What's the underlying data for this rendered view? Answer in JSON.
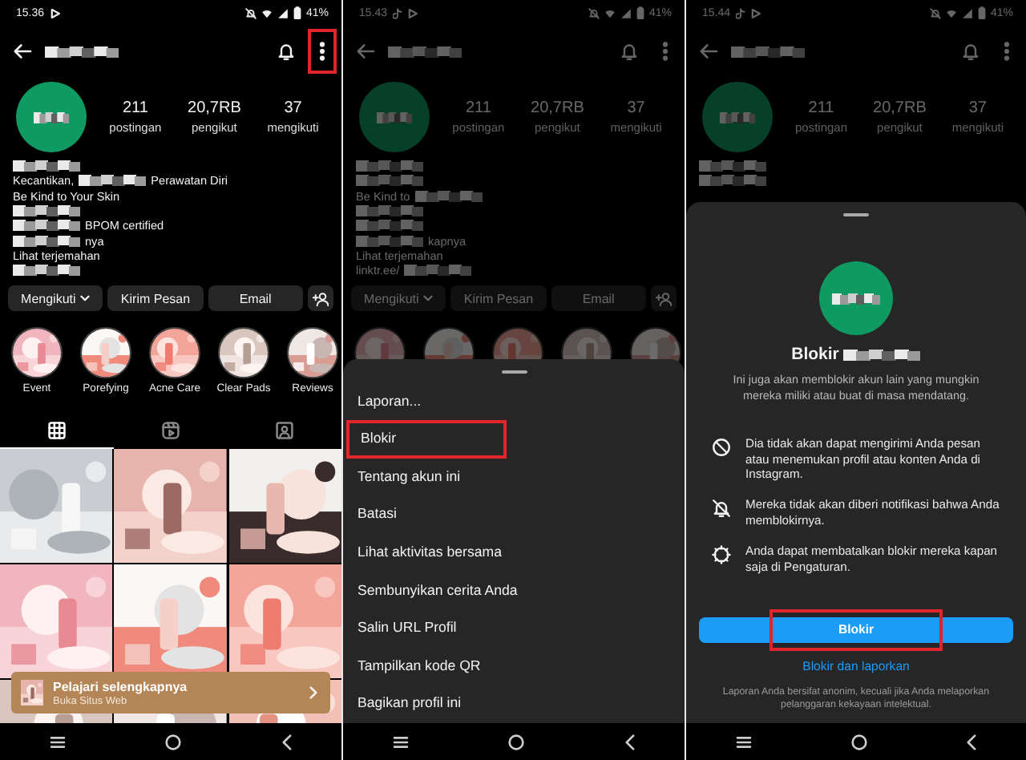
{
  "panels": [
    {
      "status": {
        "time": "15.36",
        "battery": "41%",
        "apps": [
          {
            "kind": "play"
          }
        ]
      },
      "header": {
        "menu_highlighted": true
      },
      "profile": {
        "stats": [
          {
            "value": "211",
            "label": "postingan"
          },
          {
            "value": "20,7RB",
            "label": "pengikut"
          },
          {
            "value": "37",
            "label": "mengikuti"
          }
        ],
        "bio": [
          [
            {
              "kind": "redacted"
            }
          ],
          [
            {
              "kind": "text",
              "text": "Kecantikan,"
            },
            {
              "kind": "redacted"
            },
            {
              "kind": "text",
              "text": "Perawatan Diri"
            }
          ],
          [
            {
              "kind": "text",
              "text": "Be Kind to Your Skin"
            }
          ],
          [
            {
              "kind": "redacted"
            }
          ],
          [
            {
              "kind": "redacted"
            },
            {
              "kind": "text",
              "text": "BPOM certified"
            }
          ],
          [
            {
              "kind": "redacted"
            },
            {
              "kind": "text",
              "text": "nya"
            }
          ],
          [
            {
              "kind": "text",
              "text": "Lihat terjemahan"
            }
          ],
          [
            {
              "kind": "redacted"
            }
          ]
        ],
        "buttons": [
          {
            "kind": "dropdown",
            "label": "Mengikuti"
          },
          {
            "kind": "plain",
            "label": "Kirim Pesan"
          },
          {
            "kind": "plain",
            "label": "Email"
          },
          {
            "kind": "add-person"
          }
        ],
        "highlights": [
          {
            "kind": "picture",
            "label": "Event"
          },
          {
            "kind": "picture",
            "label": "Porefying"
          },
          {
            "kind": "picture",
            "label": "Acne Care"
          },
          {
            "kind": "picture",
            "label": "Clear Pads"
          },
          {
            "kind": "picture",
            "label": "Reviews"
          }
        ]
      },
      "tabs": [
        {
          "kind": "grid",
          "selected": true
        },
        {
          "kind": "reels",
          "selected": false
        },
        {
          "kind": "tagged",
          "selected": false
        }
      ],
      "posts": [
        {
          "kind": "picture"
        },
        {
          "kind": "picture"
        },
        {
          "kind": "picture"
        },
        {
          "kind": "picture"
        },
        {
          "kind": "picture"
        },
        {
          "kind": "picture"
        },
        {
          "kind": "picture"
        },
        {
          "kind": "picture"
        },
        {
          "kind": "picture"
        }
      ],
      "ad": {
        "title": "Pelajari selengkapnya",
        "subtitle": "Buka Situs Web"
      }
    },
    {
      "status": {
        "time": "15.43",
        "battery": "41%",
        "apps": [
          {
            "kind": "note"
          },
          {
            "kind": "play"
          }
        ]
      },
      "profile": {
        "stats": [
          {
            "value": "211",
            "label": "postingan"
          },
          {
            "value": "20,7RB",
            "label": "pengikut"
          },
          {
            "value": "37",
            "label": "mengikuti"
          }
        ],
        "bio": [
          [
            {
              "kind": "redacted"
            }
          ],
          [
            {
              "kind": "redacted"
            }
          ],
          [
            {
              "kind": "text",
              "text": "Be Kind to"
            },
            {
              "kind": "redacted"
            }
          ],
          [
            {
              "kind": "redacted"
            }
          ],
          [
            {
              "kind": "redacted"
            }
          ],
          [
            {
              "kind": "redacted"
            },
            {
              "kind": "text",
              "text": "kapnya"
            }
          ],
          [
            {
              "kind": "text",
              "text": "Lihat terjemahan"
            }
          ],
          [
            {
              "kind": "text",
              "text": "linktr.ee/"
            },
            {
              "kind": "redacted"
            }
          ]
        ],
        "buttons": [
          {
            "kind": "dropdown",
            "label": "Mengikuti"
          },
          {
            "kind": "plain",
            "label": "Kirim Pesan"
          },
          {
            "kind": "plain",
            "label": "Email"
          },
          {
            "kind": "add-person"
          }
        ],
        "highlights": [
          {
            "kind": "picture"
          },
          {
            "kind": "picture"
          },
          {
            "kind": "picture"
          },
          {
            "kind": "picture"
          },
          {
            "kind": "picture"
          }
        ]
      },
      "sheet": {
        "kind": "menu",
        "items": [
          {
            "label": "Laporan...",
            "highlighted": false
          },
          {
            "label": "Blokir",
            "highlighted": true
          },
          {
            "label": "Tentang akun ini",
            "highlighted": false
          },
          {
            "label": "Batasi",
            "highlighted": false
          },
          {
            "label": "Lihat aktivitas bersama",
            "highlighted": false
          },
          {
            "label": "Sembunyikan cerita Anda",
            "highlighted": false
          },
          {
            "label": "Salin URL Profil",
            "highlighted": false
          },
          {
            "label": "Tampilkan kode QR",
            "highlighted": false
          },
          {
            "label": "Bagikan profil ini",
            "highlighted": false
          }
        ]
      }
    },
    {
      "status": {
        "time": "15.44",
        "battery": "41%",
        "apps": [
          {
            "kind": "note"
          },
          {
            "kind": "play"
          }
        ]
      },
      "profile": {
        "stats": [
          {
            "value": "211",
            "label": "postingan"
          },
          {
            "value": "20,7RB",
            "label": "pengikut"
          },
          {
            "value": "37",
            "label": "mengikuti"
          }
        ],
        "bio": [
          [
            {
              "kind": "redacted"
            }
          ],
          [
            {
              "kind": "redacted"
            }
          ]
        ]
      },
      "sheet": {
        "kind": "confirm",
        "title": "Blokir",
        "description": "Ini juga akan memblokir akun lain yang mungkin mereka miliki atau buat di masa mendatang.",
        "points": [
          {
            "kind": "no-message",
            "text": "Dia tidak akan dapat mengirimi Anda pesan atau menemukan profil atau konten Anda di Instagram."
          },
          {
            "kind": "no-notification",
            "text": "Mereka tidak akan diberi notifikasi bahwa Anda memblokirnya."
          },
          {
            "kind": "settings",
            "text": "Anda dapat membatalkan blokir mereka kapan saja di Pengaturan."
          }
        ],
        "button": {
          "label": "Blokir",
          "highlighted": true
        },
        "link": "Blokir dan laporkan",
        "footer": "Laporan Anda bersifat anonim, kecuali jika Anda melaporkan pelanggaran kekayaan intelektual."
      }
    }
  ]
}
